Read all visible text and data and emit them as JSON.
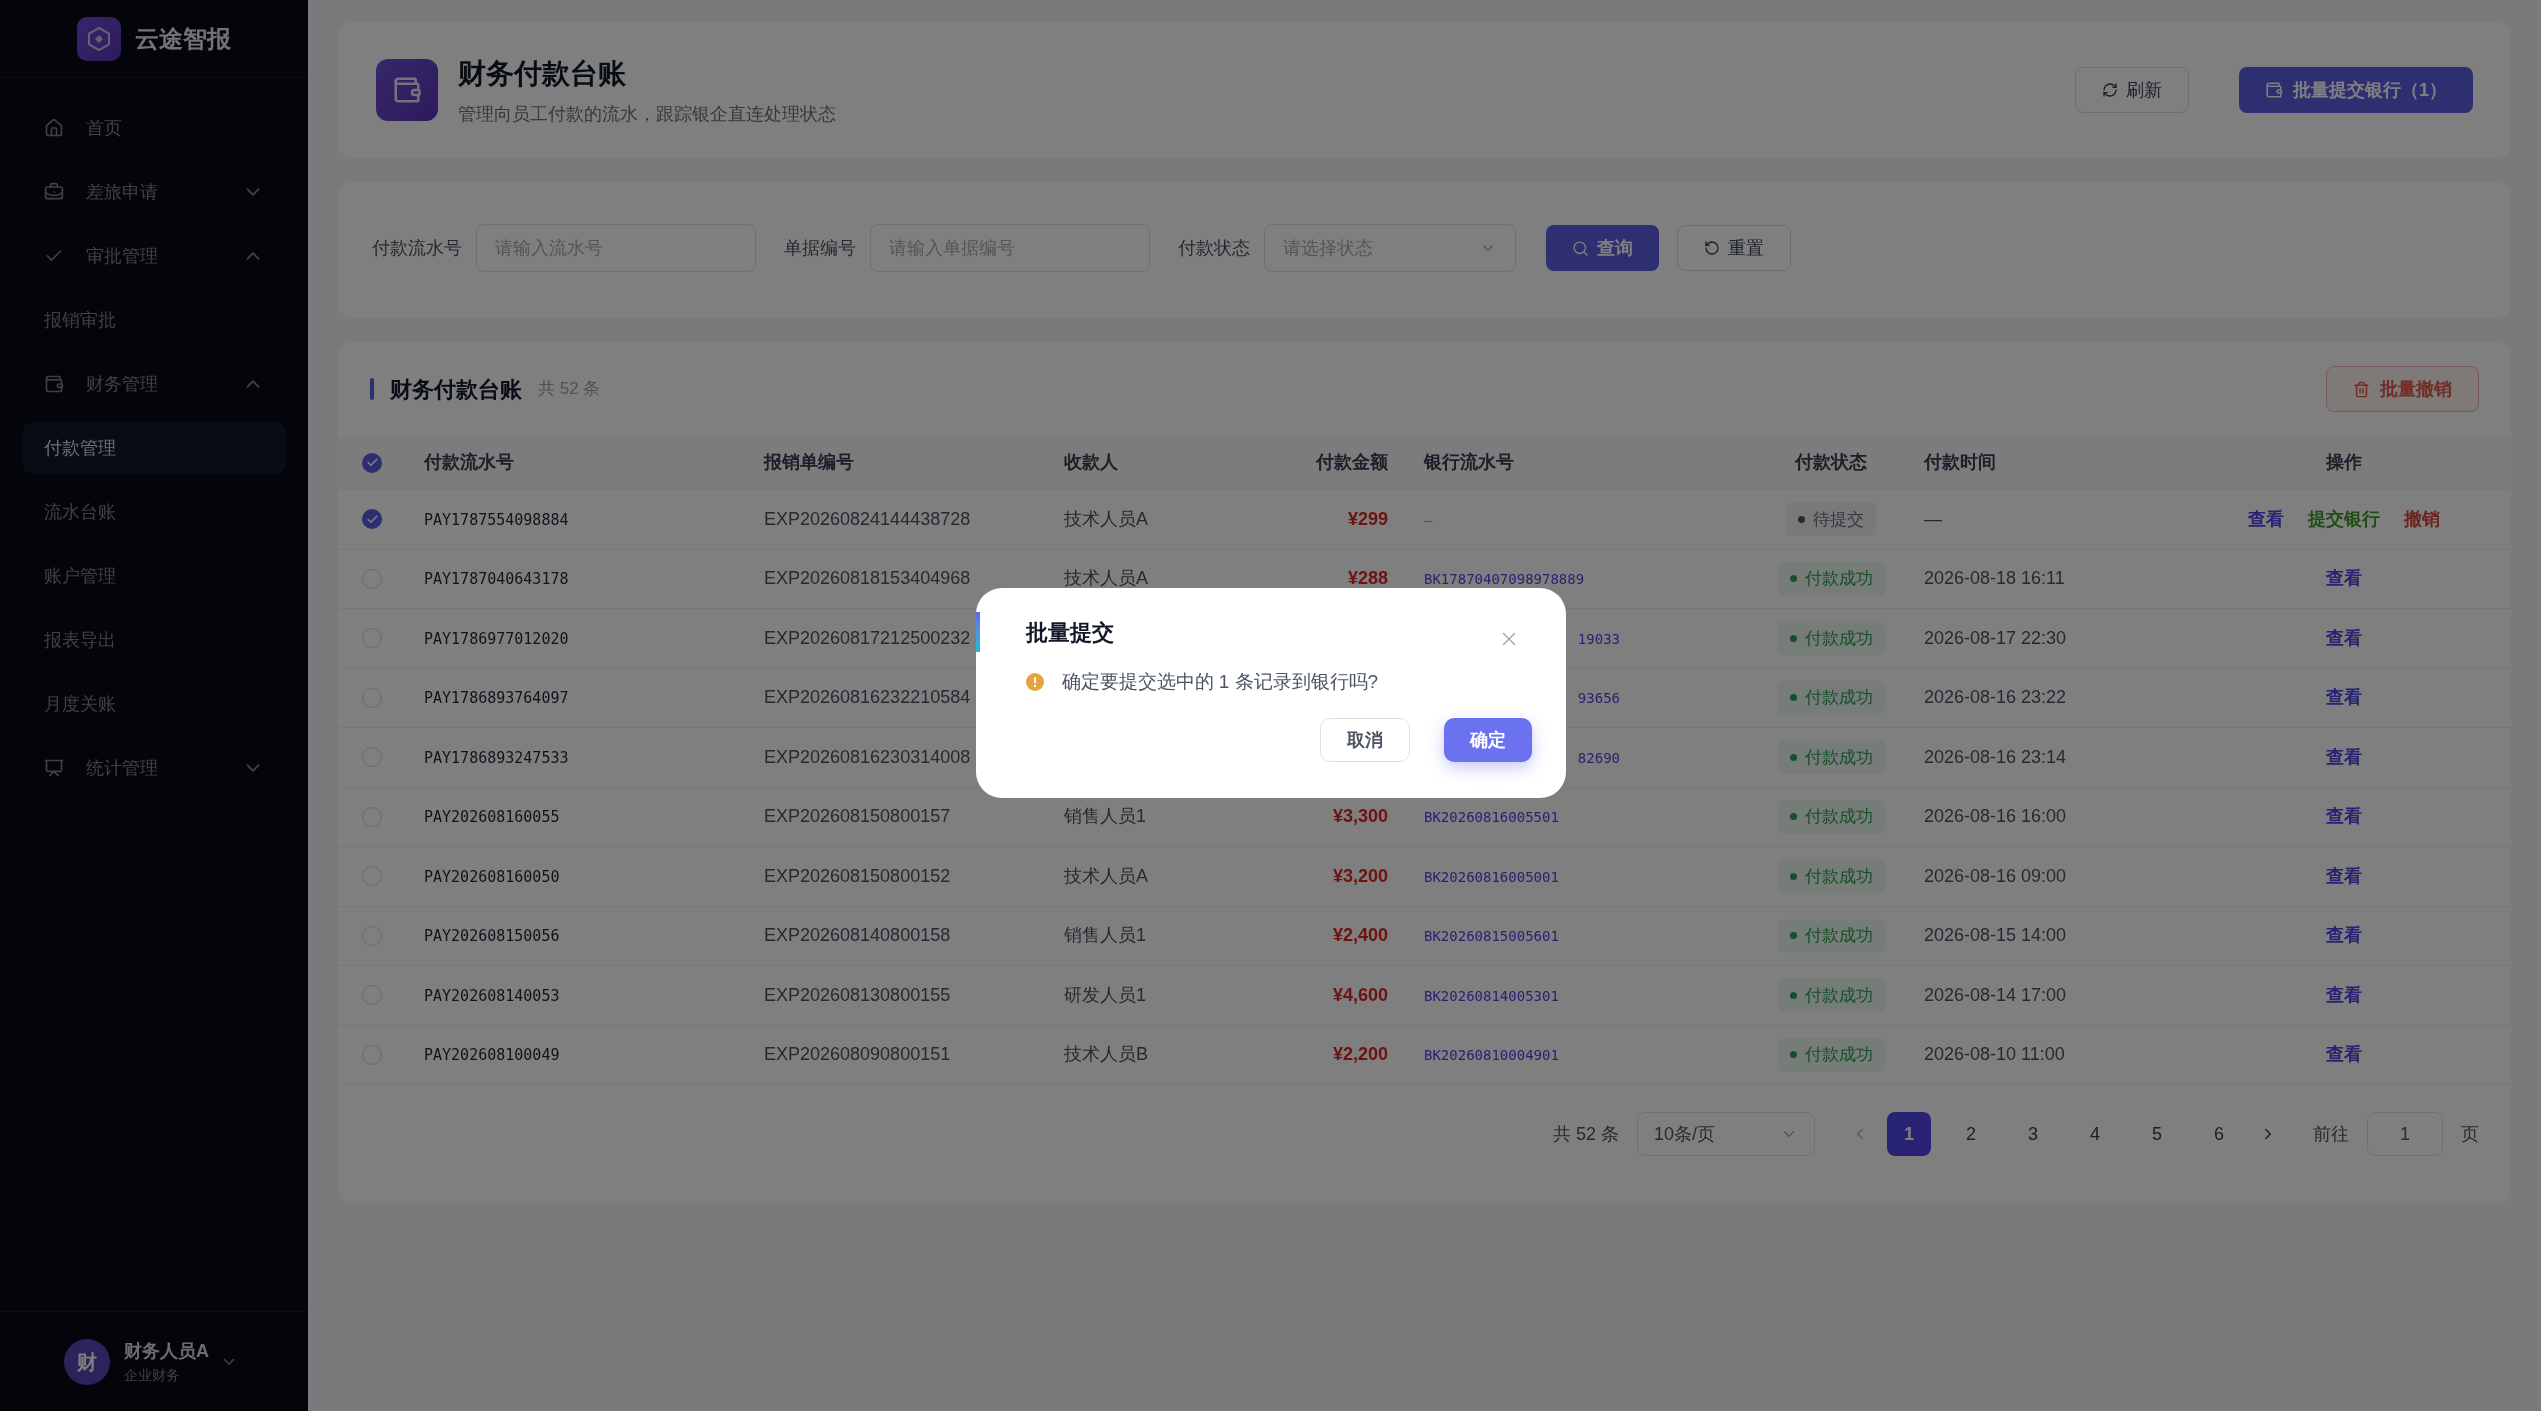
{
  "brand": {
    "name": "云途智报"
  },
  "sidebar": {
    "items": [
      {
        "label": "首页",
        "selected": false
      },
      {
        "label": "差旅申请",
        "selected": false,
        "expanded": false
      },
      {
        "label": "审批管理",
        "selected": false,
        "expanded": true,
        "children": [
          {
            "label": "报销审批",
            "selected": false
          }
        ]
      },
      {
        "label": "财务管理",
        "selected": false,
        "expanded": true,
        "children": [
          {
            "label": "付款管理",
            "selected": true
          },
          {
            "label": "流水台账",
            "selected": false
          },
          {
            "label": "账户管理",
            "selected": false
          },
          {
            "label": "报表导出",
            "selected": false
          },
          {
            "label": "月度关账",
            "selected": false
          }
        ]
      },
      {
        "label": "统计管理",
        "selected": false,
        "expanded": false
      }
    ]
  },
  "user": {
    "avatar": "财",
    "name": "财务人员A",
    "role": "企业财务"
  },
  "header": {
    "title": "财务付款台账",
    "subtitle": "管理向员工付款的流水，跟踪银企直连处理状态",
    "refresh": "刷新",
    "batch_submit": "批量提交银行（1）"
  },
  "filters": {
    "fields": [
      {
        "label": "付款流水号",
        "placeholder": "请输入流水号",
        "kind": "input"
      },
      {
        "label": "单据编号",
        "placeholder": "请输入单据编号",
        "kind": "input"
      },
      {
        "label": "付款状态",
        "placeholder": "请选择状态",
        "kind": "select"
      }
    ],
    "search": "查询",
    "reset": "重置"
  },
  "table": {
    "title": "财务付款台账",
    "count": "共 52 条",
    "batch_cancel": "批量撤销",
    "select_all": true,
    "columns": [
      "付款流水号",
      "报销单编号",
      "收款人",
      "付款金额",
      "银行流水号",
      "付款状态",
      "付款时间",
      "操作"
    ],
    "rows": [
      {
        "checked": true,
        "serial": "PAY1787554098884",
        "expense_no": "EXP20260824144438728",
        "payee": "技术人员A",
        "amount": "¥299",
        "bank_no": "—",
        "bank_clipped": false,
        "status": {
          "label": "待提交",
          "kind": "pending"
        },
        "time": "—",
        "actions": [
          {
            "label": "查看",
            "kind": "view"
          },
          {
            "label": "提交银行",
            "kind": "submit"
          },
          {
            "label": "撤销",
            "kind": "cancel"
          }
        ]
      },
      {
        "checked": false,
        "serial": "PAY1787040643178",
        "expense_no": "EXP20260818153404968",
        "payee": "技术人员A",
        "amount": "¥288",
        "bank_no": "BK17870407098978889",
        "bank_clipped": false,
        "status": {
          "label": "付款成功",
          "kind": "success"
        },
        "time": "2026-08-18 16:11",
        "actions": [
          {
            "label": "查看",
            "kind": "view"
          }
        ]
      },
      {
        "checked": false,
        "serial": "PAY1786977012020",
        "expense_no": "EXP20260817212500232",
        "bank_no": "19033",
        "bank_clipped": true,
        "status": {
          "label": "付款成功",
          "kind": "success"
        },
        "time": "2026-08-17 22:30",
        "actions": [
          {
            "label": "查看",
            "kind": "view"
          }
        ]
      },
      {
        "checked": false,
        "serial": "PAY1786893764097",
        "expense_no": "EXP20260816232210584",
        "bank_no": "93656",
        "bank_clipped": true,
        "status": {
          "label": "付款成功",
          "kind": "success"
        },
        "time": "2026-08-16 23:22",
        "actions": [
          {
            "label": "查看",
            "kind": "view"
          }
        ]
      },
      {
        "checked": false,
        "serial": "PAY1786893247533",
        "expense_no": "EXP20260816230314008",
        "bank_no": "82690",
        "bank_clipped": true,
        "status": {
          "label": "付款成功",
          "kind": "success"
        },
        "time": "2026-08-16 23:14",
        "actions": [
          {
            "label": "查看",
            "kind": "view"
          }
        ]
      },
      {
        "checked": false,
        "serial": "PAY202608160055",
        "expense_no": "EXP202608150800157",
        "payee": "销售人员1",
        "amount": "¥3,300",
        "bank_no": "BK20260816005501",
        "bank_clipped": false,
        "status": {
          "label": "付款成功",
          "kind": "success"
        },
        "time": "2026-08-16 16:00",
        "actions": [
          {
            "label": "查看",
            "kind": "view"
          }
        ]
      },
      {
        "checked": false,
        "serial": "PAY202608160050",
        "expense_no": "EXP202608150800152",
        "payee": "技术人员A",
        "amount": "¥3,200",
        "bank_no": "BK20260816005001",
        "bank_clipped": false,
        "status": {
          "label": "付款成功",
          "kind": "success"
        },
        "time": "2026-08-16 09:00",
        "actions": [
          {
            "label": "查看",
            "kind": "view"
          }
        ]
      },
      {
        "checked": false,
        "serial": "PAY202608150056",
        "expense_no": "EXP202608140800158",
        "payee": "销售人员1",
        "amount": "¥2,400",
        "bank_no": "BK20260815005601",
        "bank_clipped": false,
        "status": {
          "label": "付款成功",
          "kind": "success"
        },
        "time": "2026-08-15 14:00",
        "actions": [
          {
            "label": "查看",
            "kind": "view"
          }
        ]
      },
      {
        "checked": false,
        "serial": "PAY202608140053",
        "expense_no": "EXP202608130800155",
        "payee": "研发人员1",
        "amount": "¥4,600",
        "bank_no": "BK20260814005301",
        "bank_clipped": false,
        "status": {
          "label": "付款成功",
          "kind": "success"
        },
        "time": "2026-08-14 17:00",
        "actions": [
          {
            "label": "查看",
            "kind": "view"
          }
        ]
      },
      {
        "checked": false,
        "serial": "PAY202608100049",
        "expense_no": "EXP202608090800151",
        "payee": "技术人员B",
        "amount": "¥2,200",
        "bank_no": "BK20260810004901",
        "bank_clipped": false,
        "status": {
          "label": "付款成功",
          "kind": "success"
        },
        "time": "2026-08-10 11:00",
        "actions": [
          {
            "label": "查看",
            "kind": "view"
          }
        ]
      }
    ]
  },
  "pagination": {
    "total": "共 52 条",
    "page_size": "10条/页",
    "pages": [
      {
        "label": "1",
        "selected": true
      },
      {
        "label": "2",
        "selected": false
      },
      {
        "label": "3",
        "selected": false
      },
      {
        "label": "4",
        "selected": false
      },
      {
        "label": "5",
        "selected": false
      },
      {
        "label": "6",
        "selected": false
      }
    ],
    "goto_label": "前往",
    "goto_value": "1",
    "page_suffix": "页"
  },
  "modal": {
    "title": "批量提交",
    "message": "确定要提交选中的 1 条记录到银行吗?",
    "cancel": "取消",
    "confirm": "确定"
  }
}
